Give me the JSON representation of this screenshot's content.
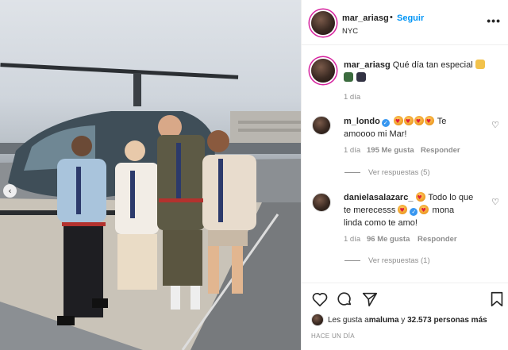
{
  "post": {
    "username": "mar_ariasg",
    "separator": "•",
    "follow_label": "Seguir",
    "location": "NYC",
    "more_label": "•••"
  },
  "caption": {
    "username": "mar_ariasg",
    "text": "Qué día tan especial",
    "time": "1 día"
  },
  "comments": [
    {
      "username": "m_londo",
      "verified": true,
      "text_line1": "Te",
      "text_line2": "amoooo mi Mar!",
      "time": "1 día",
      "likes": "195 Me gusta",
      "reply_label": "Responder",
      "view_replies": "Ver respuestas (5)"
    },
    {
      "username": "danielasalazarc_",
      "verified": true,
      "text_line1": "Todo lo que",
      "text_line2": "te merecesss",
      "text_line3": "mona",
      "text_line4": "linda como te amo!",
      "time": "1 día",
      "likes": "96 Me gusta",
      "reply_label": "Responder",
      "view_replies": "Ver respuestas (1)"
    }
  ],
  "actions": {
    "likes_prefix": "Les gusta a ",
    "likes_user": "maluma",
    "likes_middle": " y ",
    "likes_count": "32.573 personas más",
    "time_ago": "HACE UN DÍA"
  },
  "icons": {
    "heart": "heart-icon",
    "comment": "comment-icon",
    "share": "share-icon",
    "save": "bookmark-icon",
    "carousel": "chevron-left-icon"
  },
  "colors": {
    "link": "#0095f6",
    "verified": "#3897f0",
    "muted": "#8e8e8e",
    "border": "#efefef"
  }
}
